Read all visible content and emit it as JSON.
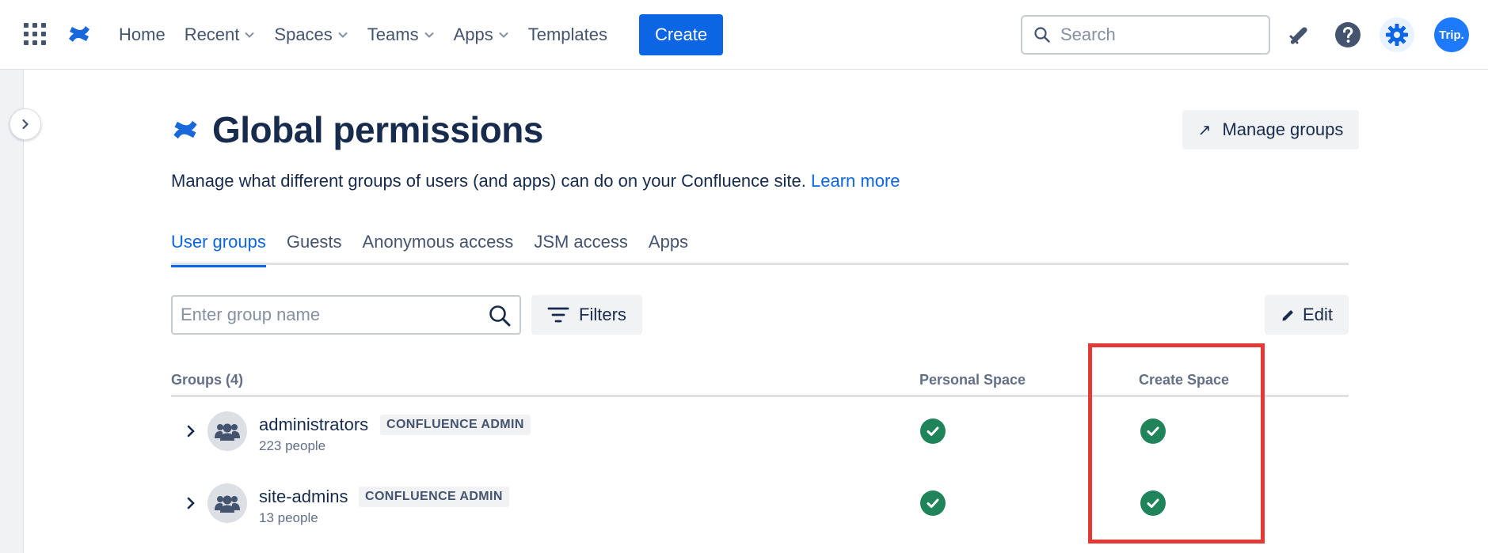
{
  "nav": {
    "home": "Home",
    "recent": "Recent",
    "spaces": "Spaces",
    "teams": "Teams",
    "apps": "Apps",
    "templates": "Templates",
    "create": "Create",
    "search_placeholder": "Search",
    "avatar_initials": "Trip."
  },
  "page": {
    "title": "Global permissions",
    "manage_groups": "Manage groups",
    "description": "Manage what different groups of users (and apps) can do on your Confluence site.",
    "learn_more": "Learn more"
  },
  "tabs": [
    {
      "label": "User groups",
      "active": true
    },
    {
      "label": "Guests",
      "active": false
    },
    {
      "label": "Anonymous access",
      "active": false
    },
    {
      "label": "JSM access",
      "active": false
    },
    {
      "label": "Apps",
      "active": false
    }
  ],
  "toolbar": {
    "group_search_placeholder": "Enter group name",
    "filters": "Filters",
    "edit": "Edit"
  },
  "table": {
    "headers": {
      "groups": "Groups (4)",
      "personal_space": "Personal Space",
      "create_space": "Create Space"
    },
    "rows": [
      {
        "name": "administrators",
        "badge": "CONFLUENCE ADMIN",
        "count": "223 people",
        "personal_space": true,
        "create_space": true
      },
      {
        "name": "site-admins",
        "badge": "CONFLUENCE ADMIN",
        "count": "13 people",
        "personal_space": true,
        "create_space": true
      }
    ]
  },
  "colors": {
    "primary": "#0c66e4",
    "check": "#1f845a",
    "highlight": "#e53935",
    "text": "#172b4d"
  }
}
